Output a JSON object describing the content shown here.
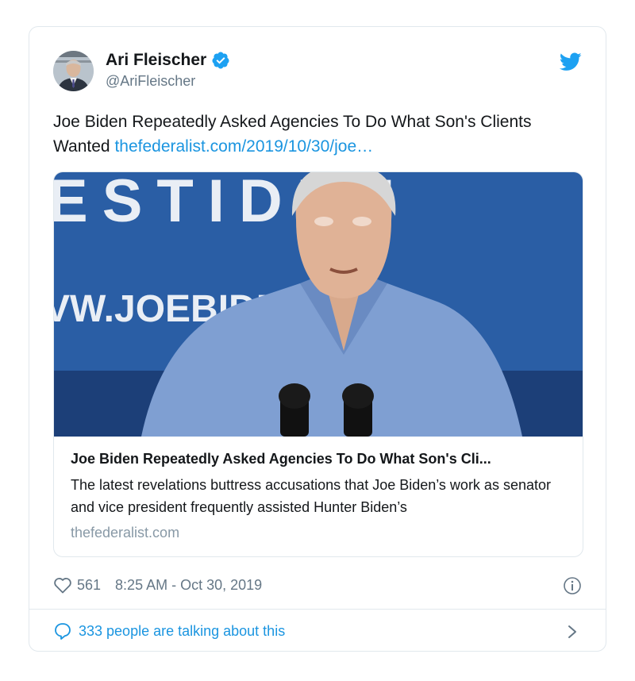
{
  "author": {
    "name": "Ari Fleischer",
    "handle": "@AriFleischer",
    "avatar_icon": "user-avatar",
    "verified_icon": "verified-badge-icon"
  },
  "tweet": {
    "text": "Joe Biden Repeatedly Asked Agencies To Do What Son's Clients Wanted",
    "link_text": "thefederalist.com/2019/10/30/joe…"
  },
  "card": {
    "image_banner_text_top": "ESTIDEN",
    "image_banner_text_url": "VW.JOEBIDEN.COM",
    "title": "Joe Biden Repeatedly Asked Agencies To Do What Son's Cli...",
    "description": "The latest revelations buttress accusations that Joe Biden’s work as senator and vice president frequently assisted Hunter Biden’s",
    "domain": "thefederalist.com"
  },
  "meta": {
    "likes": "561",
    "timestamp": "8:25 AM - Oct 30, 2019"
  },
  "footer": {
    "talking": "333 people are talking about this"
  },
  "colors": {
    "link": "#1b95e0",
    "secondary": "#657786",
    "border": "#e1e8ed",
    "banner_blue": "#2a5ea5"
  }
}
